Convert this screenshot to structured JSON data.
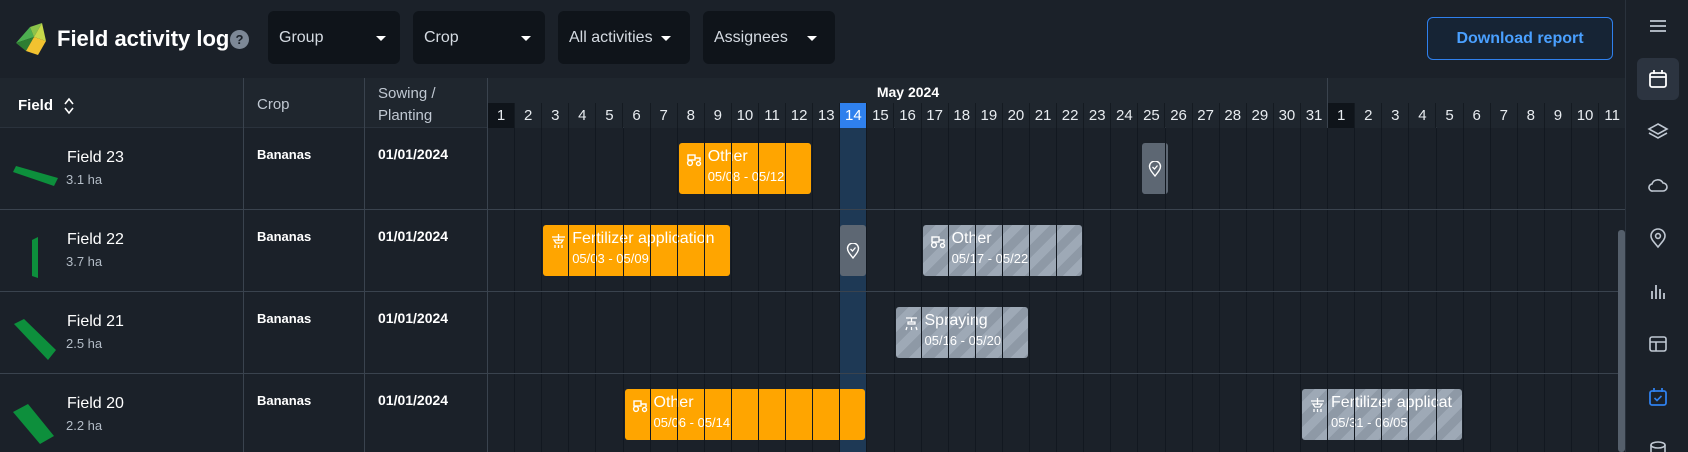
{
  "header": {
    "title": "Field activity log",
    "help": "?",
    "download_label": "Download report",
    "filters": [
      {
        "label": "Group"
      },
      {
        "label": "Crop"
      },
      {
        "label": "All activities"
      },
      {
        "label": "Assignees"
      }
    ]
  },
  "sidebar": {
    "icons": [
      "menu-icon",
      "calendar-icon",
      "layers-icon",
      "cloud-icon",
      "location-pin-icon",
      "bar-chart-icon",
      "layout-icon",
      "calendar-check-icon",
      "database-icon"
    ],
    "active": "calendar-icon"
  },
  "table": {
    "headers": {
      "field": "Field",
      "crop": "Crop",
      "sowing_line1": "Sowing /",
      "sowing_line2": "Planting"
    },
    "month": "May 2024",
    "today": 14,
    "days_may": [
      1,
      2,
      3,
      4,
      5,
      6,
      7,
      8,
      9,
      10,
      11,
      12,
      13,
      14,
      15,
      16,
      17,
      18,
      19,
      20,
      21,
      22,
      23,
      24,
      25,
      26,
      27,
      28,
      29,
      30,
      31
    ],
    "days_june": [
      1,
      2,
      3,
      4,
      5,
      6,
      7,
      8,
      9,
      10,
      11
    ],
    "rows": [
      {
        "name": "Field 23",
        "area": "3.1 ha",
        "crop": "Bananas",
        "sowing": "01/01/2024"
      },
      {
        "name": "Field 22",
        "area": "3.7 ha",
        "crop": "Bananas",
        "sowing": "01/01/2024"
      },
      {
        "name": "Field 21",
        "area": "2.5 ha",
        "crop": "Bananas",
        "sowing": "01/01/2024"
      },
      {
        "name": "Field 20",
        "area": "2.2 ha",
        "crop": "Bananas",
        "sowing": "01/01/2024"
      }
    ]
  },
  "activities": [
    {
      "row": 0,
      "label": "Other",
      "dates": "05/08 - 05/12",
      "status": "planned",
      "icon": "tractor-icon"
    },
    {
      "row": 1,
      "label": "Fertilizer application",
      "dates": "05/03 - 05/09",
      "status": "planned",
      "icon": "fertilizer-icon"
    },
    {
      "row": 1,
      "label": "Other",
      "dates": "05/17 - 05/22",
      "status": "future",
      "icon": "tractor-icon"
    },
    {
      "row": 2,
      "label": "Spraying",
      "dates": "05/16 - 05/20",
      "status": "future",
      "icon": "spraying-icon"
    },
    {
      "row": 3,
      "label": "Other",
      "dates": "05/06 - 05/14",
      "status": "planned",
      "icon": "tractor-icon"
    },
    {
      "row": 3,
      "label": "Fertilizer applicat",
      "dates": "05/31 - 06/05",
      "status": "future",
      "icon": "fertilizer-icon"
    }
  ],
  "colors": {
    "accent": "#2f80ed",
    "planned": "#ffa500",
    "future": "#9ea9b6",
    "field": "#0d8f3c"
  }
}
